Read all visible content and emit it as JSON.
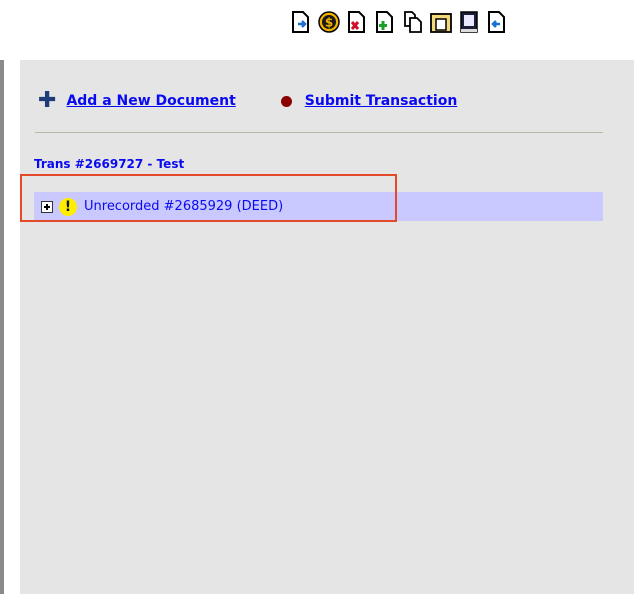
{
  "toolbar": {
    "buttons": [
      {
        "icon": "document-arrow-icon"
      },
      {
        "icon": "dollar-coin-icon"
      },
      {
        "icon": "document-delete-icon"
      },
      {
        "icon": "document-add-icon"
      },
      {
        "icon": "copy-documents-icon"
      },
      {
        "icon": "folder-icon"
      },
      {
        "icon": "book-icon"
      },
      {
        "icon": "document-return-icon"
      }
    ],
    "dollar_symbol": "$"
  },
  "actions": {
    "add_label": "Add a New Document",
    "submit_label": "Submit Transaction"
  },
  "transaction": {
    "title": "Trans #2669727 - Test"
  },
  "tree": {
    "item_label": "Unrecorded #2685929 (DEED)",
    "warning_symbol": "!"
  },
  "colors": {
    "link": "#0a0af0",
    "row_highlight": "#c9c9ff",
    "panel_bg": "#e5e5e5",
    "annotation_box": "#e24a2a"
  }
}
